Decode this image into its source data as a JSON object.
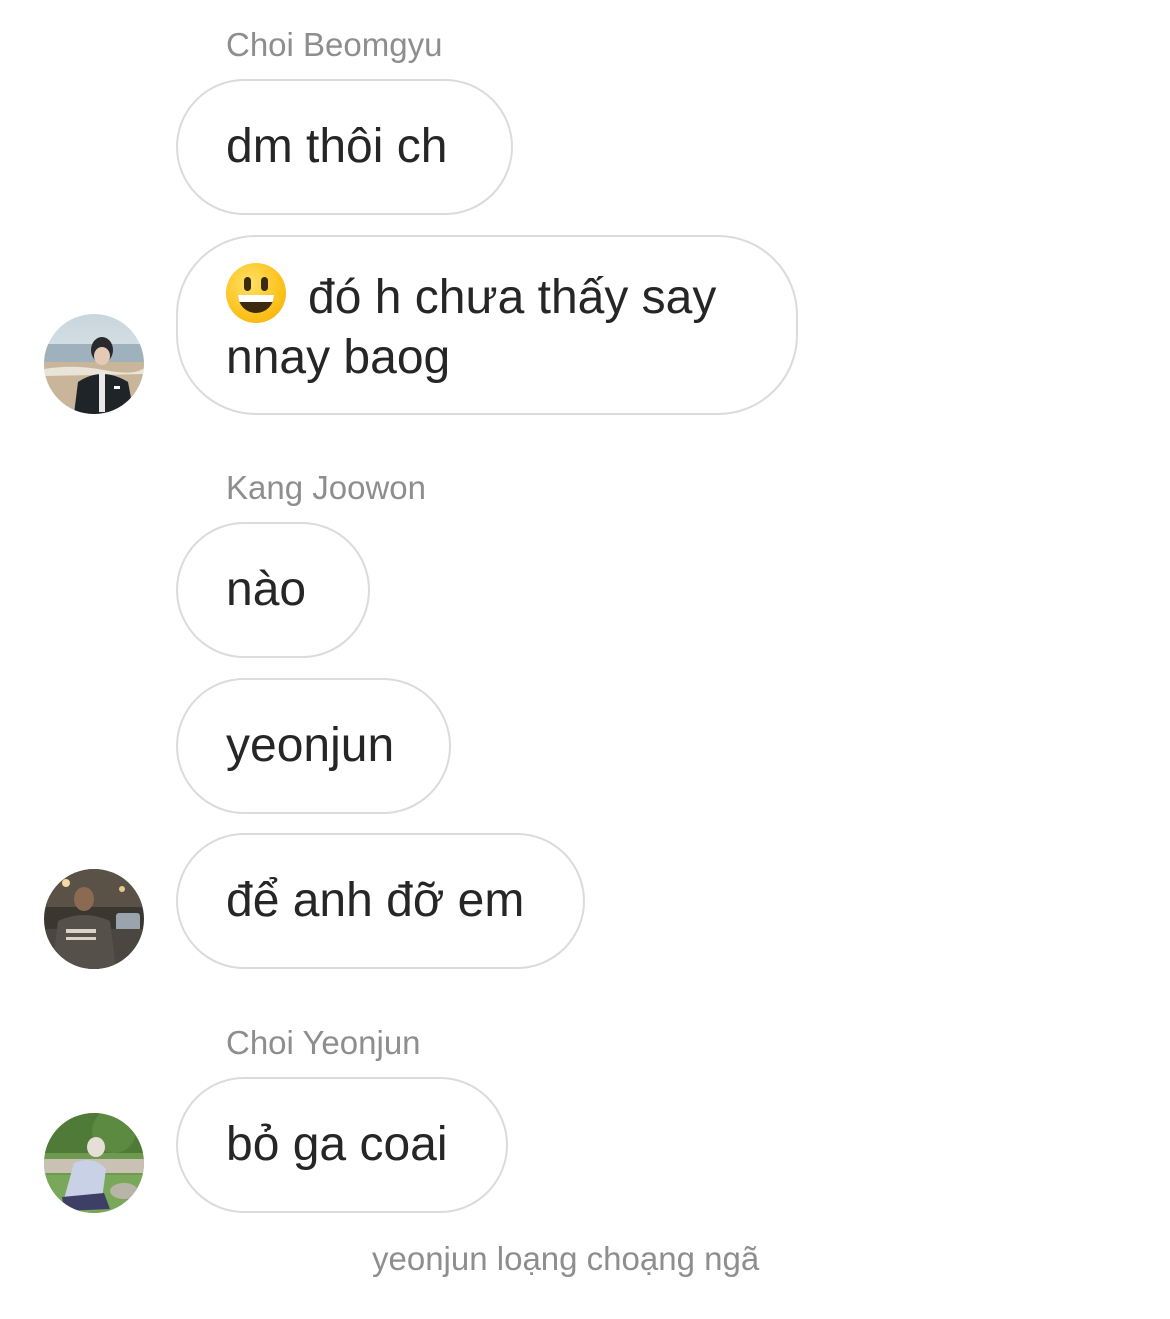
{
  "thread": {
    "groups": [
      {
        "sender": "Choi Beomgyu",
        "avatar": "avatar-photo-beach",
        "messages": [
          {
            "text": "dm thôi ch"
          },
          {
            "emoji": "grinning-face-emoji",
            "text": "đó h chưa thấy say nnay baog"
          }
        ]
      },
      {
        "sender": "Kang Joowon",
        "avatar": "avatar-photo-street-night",
        "messages": [
          {
            "text": "nào"
          },
          {
            "text": "yeonjun"
          },
          {
            "text": "để anh đỡ em"
          }
        ]
      },
      {
        "sender": "Choi Yeonjun",
        "avatar": "avatar-photo-park",
        "messages": [
          {
            "text": "bỏ ga coai"
          }
        ]
      }
    ],
    "system_message": "yeonjun loạng choạng ngã"
  },
  "colors": {
    "bubble_border": "#dbdbdb",
    "bubble_text": "#262626",
    "secondary_text": "#8e8e8e",
    "background": "#ffffff"
  }
}
